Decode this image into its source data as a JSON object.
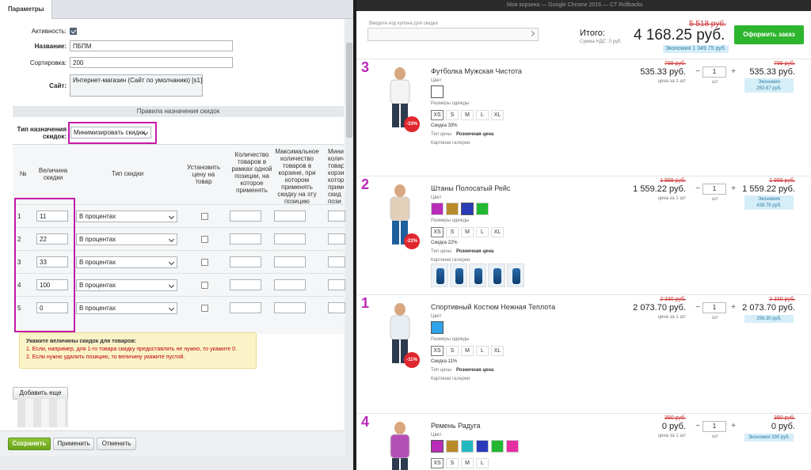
{
  "left": {
    "tab_label": "Параметры",
    "fields": {
      "activity_label": "Активность:",
      "name_label": "Название:",
      "name_value": "ПБПМ",
      "sort_label": "Сортировка:",
      "sort_value": "200",
      "site_label": "Сайт:",
      "site_value": "Интернет-магазин (Сайт по умолчанию) [s1]"
    },
    "section_title": "Правила назначения скидок",
    "discount_type_label": "Тип назначения скидок:",
    "discount_type_value": "Минимизировать скидки",
    "table": {
      "headers": {
        "num": "№",
        "value": "Величина скидки",
        "type": "Тип скидки",
        "set_price": "Установить цену на товар",
        "qty_position": "Количество товаров в рамках одной позиции, на которое применять",
        "max_qty": "Максимальное количество товаров в корзине, при котором применять скидку на эту позицию",
        "min_qty": "Мини колич товар корзи котор приме скид пози"
      },
      "rows": [
        {
          "n": "1",
          "value": "11",
          "type": "В процентах"
        },
        {
          "n": "2",
          "value": "22",
          "type": "В процентах"
        },
        {
          "n": "3",
          "value": "33",
          "type": "В процентах"
        },
        {
          "n": "4",
          "value": "100",
          "type": "В процентах"
        },
        {
          "n": "5",
          "value": "0",
          "type": "В процентах"
        }
      ]
    },
    "hint": {
      "title": "Укажите величины скидок для товаров:",
      "line1": "1. Если, например, для 1-го товара скидку предоставлять не нужно, то укажите 0.",
      "line2": "2. Если нужно удалить позицию, то величину укажите пустой."
    },
    "add_more_label": "Добавить еще",
    "buttons": {
      "save": "Сохранить",
      "apply": "Применить",
      "cancel": "Отменить"
    }
  },
  "right": {
    "top_strip_text": "Моя корзина — Google Chrome 2016 — CT Rollbacks",
    "coupon_placeholder": "Введите код купона для скидки",
    "total_label": "Итого:",
    "vat_label": "Сумма НДС: 0 руб.",
    "old_total": "5 518 руб.",
    "total": "4 168.25 руб.",
    "total_saving": "Экономия 1 349.75 руб.",
    "order_button": "Оформить заказ",
    "items": [
      {
        "order": "3",
        "name": "Футболка Мужская Чистота",
        "badge": "-33%",
        "color_label": "Цвет",
        "colors": [
          "#ffffff"
        ],
        "size_label": "Размеры одежды",
        "sizes": [
          "XS",
          "S",
          "M",
          "L",
          "XL"
        ],
        "discount_text": "Скидка 33%",
        "price_type_label": "Тип цены",
        "price_type_value": "Розничная цена",
        "gallery_label": "Картинки галереи",
        "old_price": "799 руб.",
        "price": "535.33 руб.",
        "unit_price": "цена за 1 шт",
        "qty": "1",
        "qty_unit": "шт",
        "old_sum": "799 руб.",
        "sum": "535.33 руб.",
        "saving_label": "Экономия",
        "saving_value": "263.67 руб."
      },
      {
        "order": "2",
        "name": "Штаны Полосатый Рейс",
        "badge": "-22%",
        "color_label": "Цвет",
        "colors": [
          "#b82cb8",
          "#b88a28",
          "#2a3ab8",
          "#22b832"
        ],
        "size_label": "Размеры одежды",
        "sizes": [
          "XS",
          "S",
          "M",
          "L",
          "XL"
        ],
        "discount_text": "Скидка 22%",
        "price_type_label": "Тип цены",
        "price_type_value": "Розничная цена",
        "gallery_label": "Картинки галереи",
        "old_price": "1 999 руб.",
        "price": "1 559.22 руб.",
        "unit_price": "цена за 1 шт",
        "qty": "1",
        "qty_unit": "шт",
        "old_sum": "1 999 руб.",
        "sum": "1 559.22 руб.",
        "saving_label": "Экономия",
        "saving_value": "439.78 руб."
      },
      {
        "order": "1",
        "name": "Спортивный Костюм Нежная Теплота",
        "badge": "-11%",
        "color_label": "Цвет",
        "colors": [
          "#2ea3e8"
        ],
        "size_label": "Размеры одежды",
        "sizes": [
          "XS",
          "S",
          "M",
          "L",
          "XL"
        ],
        "discount_text": "Скидка 11%",
        "price_type_label": "Тип цены",
        "price_type_value": "Розничная цена",
        "gallery_label": "Картинки галереи",
        "old_price": "2 330 руб.",
        "price": "2 073.70 руб.",
        "unit_price": "цена за 1 шт",
        "qty": "1",
        "qty_unit": "шт",
        "old_sum": "2 330 руб.",
        "sum": "2 073.70 руб.",
        "saving_value": "256.30 руб."
      },
      {
        "order": "4",
        "name": "Ремень Радуга",
        "badge": "-100%",
        "color_label": "Цвет",
        "colors": [
          "#b82cb8",
          "#b88a28",
          "#22b8c0",
          "#2a3ab8",
          "#22b832",
          "#e82ea3"
        ],
        "sizes": [
          "XS",
          "S",
          "M",
          "L"
        ],
        "old_price": "390 руб.",
        "price": "0 руб.",
        "unit_price": "цена за 1 шт",
        "qty": "1",
        "qty_unit": "шт",
        "old_sum": "390 руб.",
        "sum": "0 руб.",
        "saving_value": "Экономия 390 руб."
      }
    ]
  }
}
